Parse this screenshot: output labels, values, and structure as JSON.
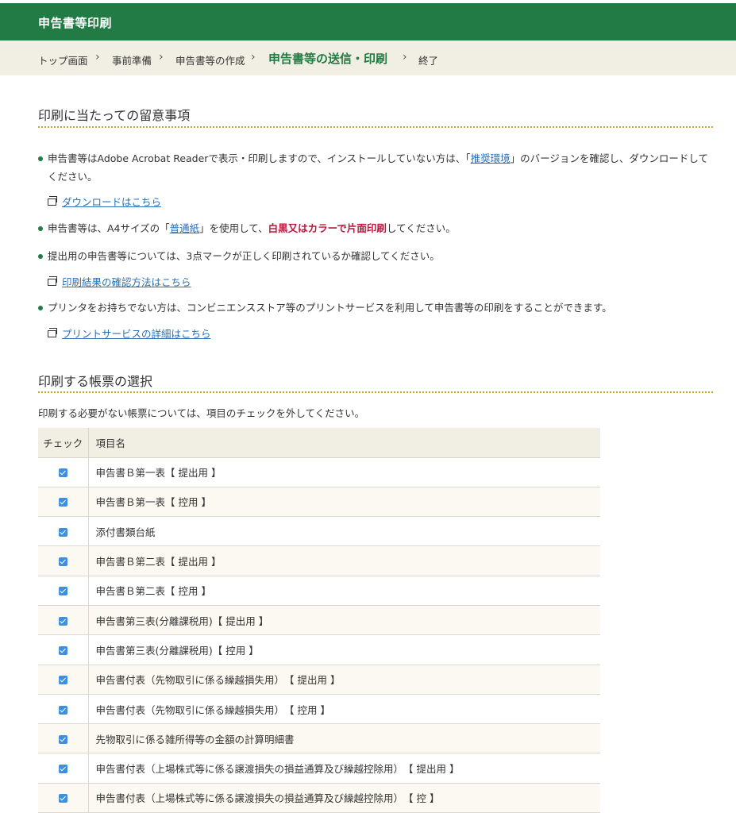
{
  "header": {
    "title": "申告書等印刷"
  },
  "breadcrumb": {
    "items": [
      {
        "label": "トップ画面"
      },
      {
        "label": "事前準備"
      },
      {
        "label": "申告書等の作成"
      },
      {
        "label": "申告書等の送信・印刷"
      },
      {
        "label": "終了"
      }
    ],
    "separator": "›"
  },
  "notes": {
    "heading": "印刷に当たっての留意事項",
    "item1": {
      "text_before": "申告書等はAdobe Acrobat Readerで表示・印刷しますので、インストールしていない方は、「",
      "link": "推奨環境",
      "text_after": "」のバージョンを確認し、ダウンロードしてください。"
    },
    "link_download": "ダウンロードはこちら",
    "item2": {
      "text_before": "申告書等は、A4サイズの「",
      "link": "普通紙",
      "text_middle": "」を使用して、",
      "warning": "白黒又はカラーで片面印刷",
      "text_after": "してください。"
    },
    "item3": "提出用の申告書等については、3点マークが正しく印刷されているか確認してください。",
    "link_confirm": "印刷結果の確認方法はこちら",
    "item4": "プリンタをお持ちでない方は、コンビニエンスストア等のプリントサービスを利用して申告書等の印刷をすることができます。",
    "link_print_service": "プリントサービスの詳細はこちら"
  },
  "selection": {
    "heading": "印刷する帳票の選択",
    "instruction": "印刷する必要がない帳票については、項目のチェックを外してください。",
    "columns": {
      "check": "チェック",
      "name": "項目名"
    },
    "rows": [
      {
        "name": "申告書Ｂ第一表【 提出用 】",
        "checked": true
      },
      {
        "name": "申告書Ｂ第一表【 控用 】",
        "checked": true
      },
      {
        "name": "添付書類台紙",
        "checked": true
      },
      {
        "name": "申告書Ｂ第二表【 提出用 】",
        "checked": true
      },
      {
        "name": "申告書Ｂ第二表【 控用 】",
        "checked": true
      },
      {
        "name": "申告書第三表(分離課税用)【 提出用 】",
        "checked": true
      },
      {
        "name": "申告書第三表(分離課税用)【 控用 】",
        "checked": true
      },
      {
        "name": "申告書付表（先物取引に係る繰越損失用）　【 提出用 】",
        "checked": true
      },
      {
        "name": "申告書付表（先物取引に係る繰越損失用）　【 控用 】",
        "checked": true
      },
      {
        "name": "先物取引に係る雑所得等の金額の計算明細書",
        "checked": true
      },
      {
        "name": "申告書付表（上場株式等に係る譲渡損失の損益通算及び繰越控除用）　【 提出用 】",
        "checked": true
      },
      {
        "name": "申告書付表（上場株式等に係る譲渡損失の損益通算及び繰越控除用）　【 控 】",
        "checked": true
      }
    ]
  },
  "colors": {
    "brand_green": "#227b45",
    "breadcrumb_bg": "#f1efe4",
    "link_blue": "#2a6fb6",
    "warning_red": "#c0143c",
    "checkbox_blue": "#3f8fde",
    "rule_gold": "#c8a22f"
  },
  "icons": {
    "external_link": "window-icon",
    "checkbox": "checkbox-checked-icon"
  }
}
